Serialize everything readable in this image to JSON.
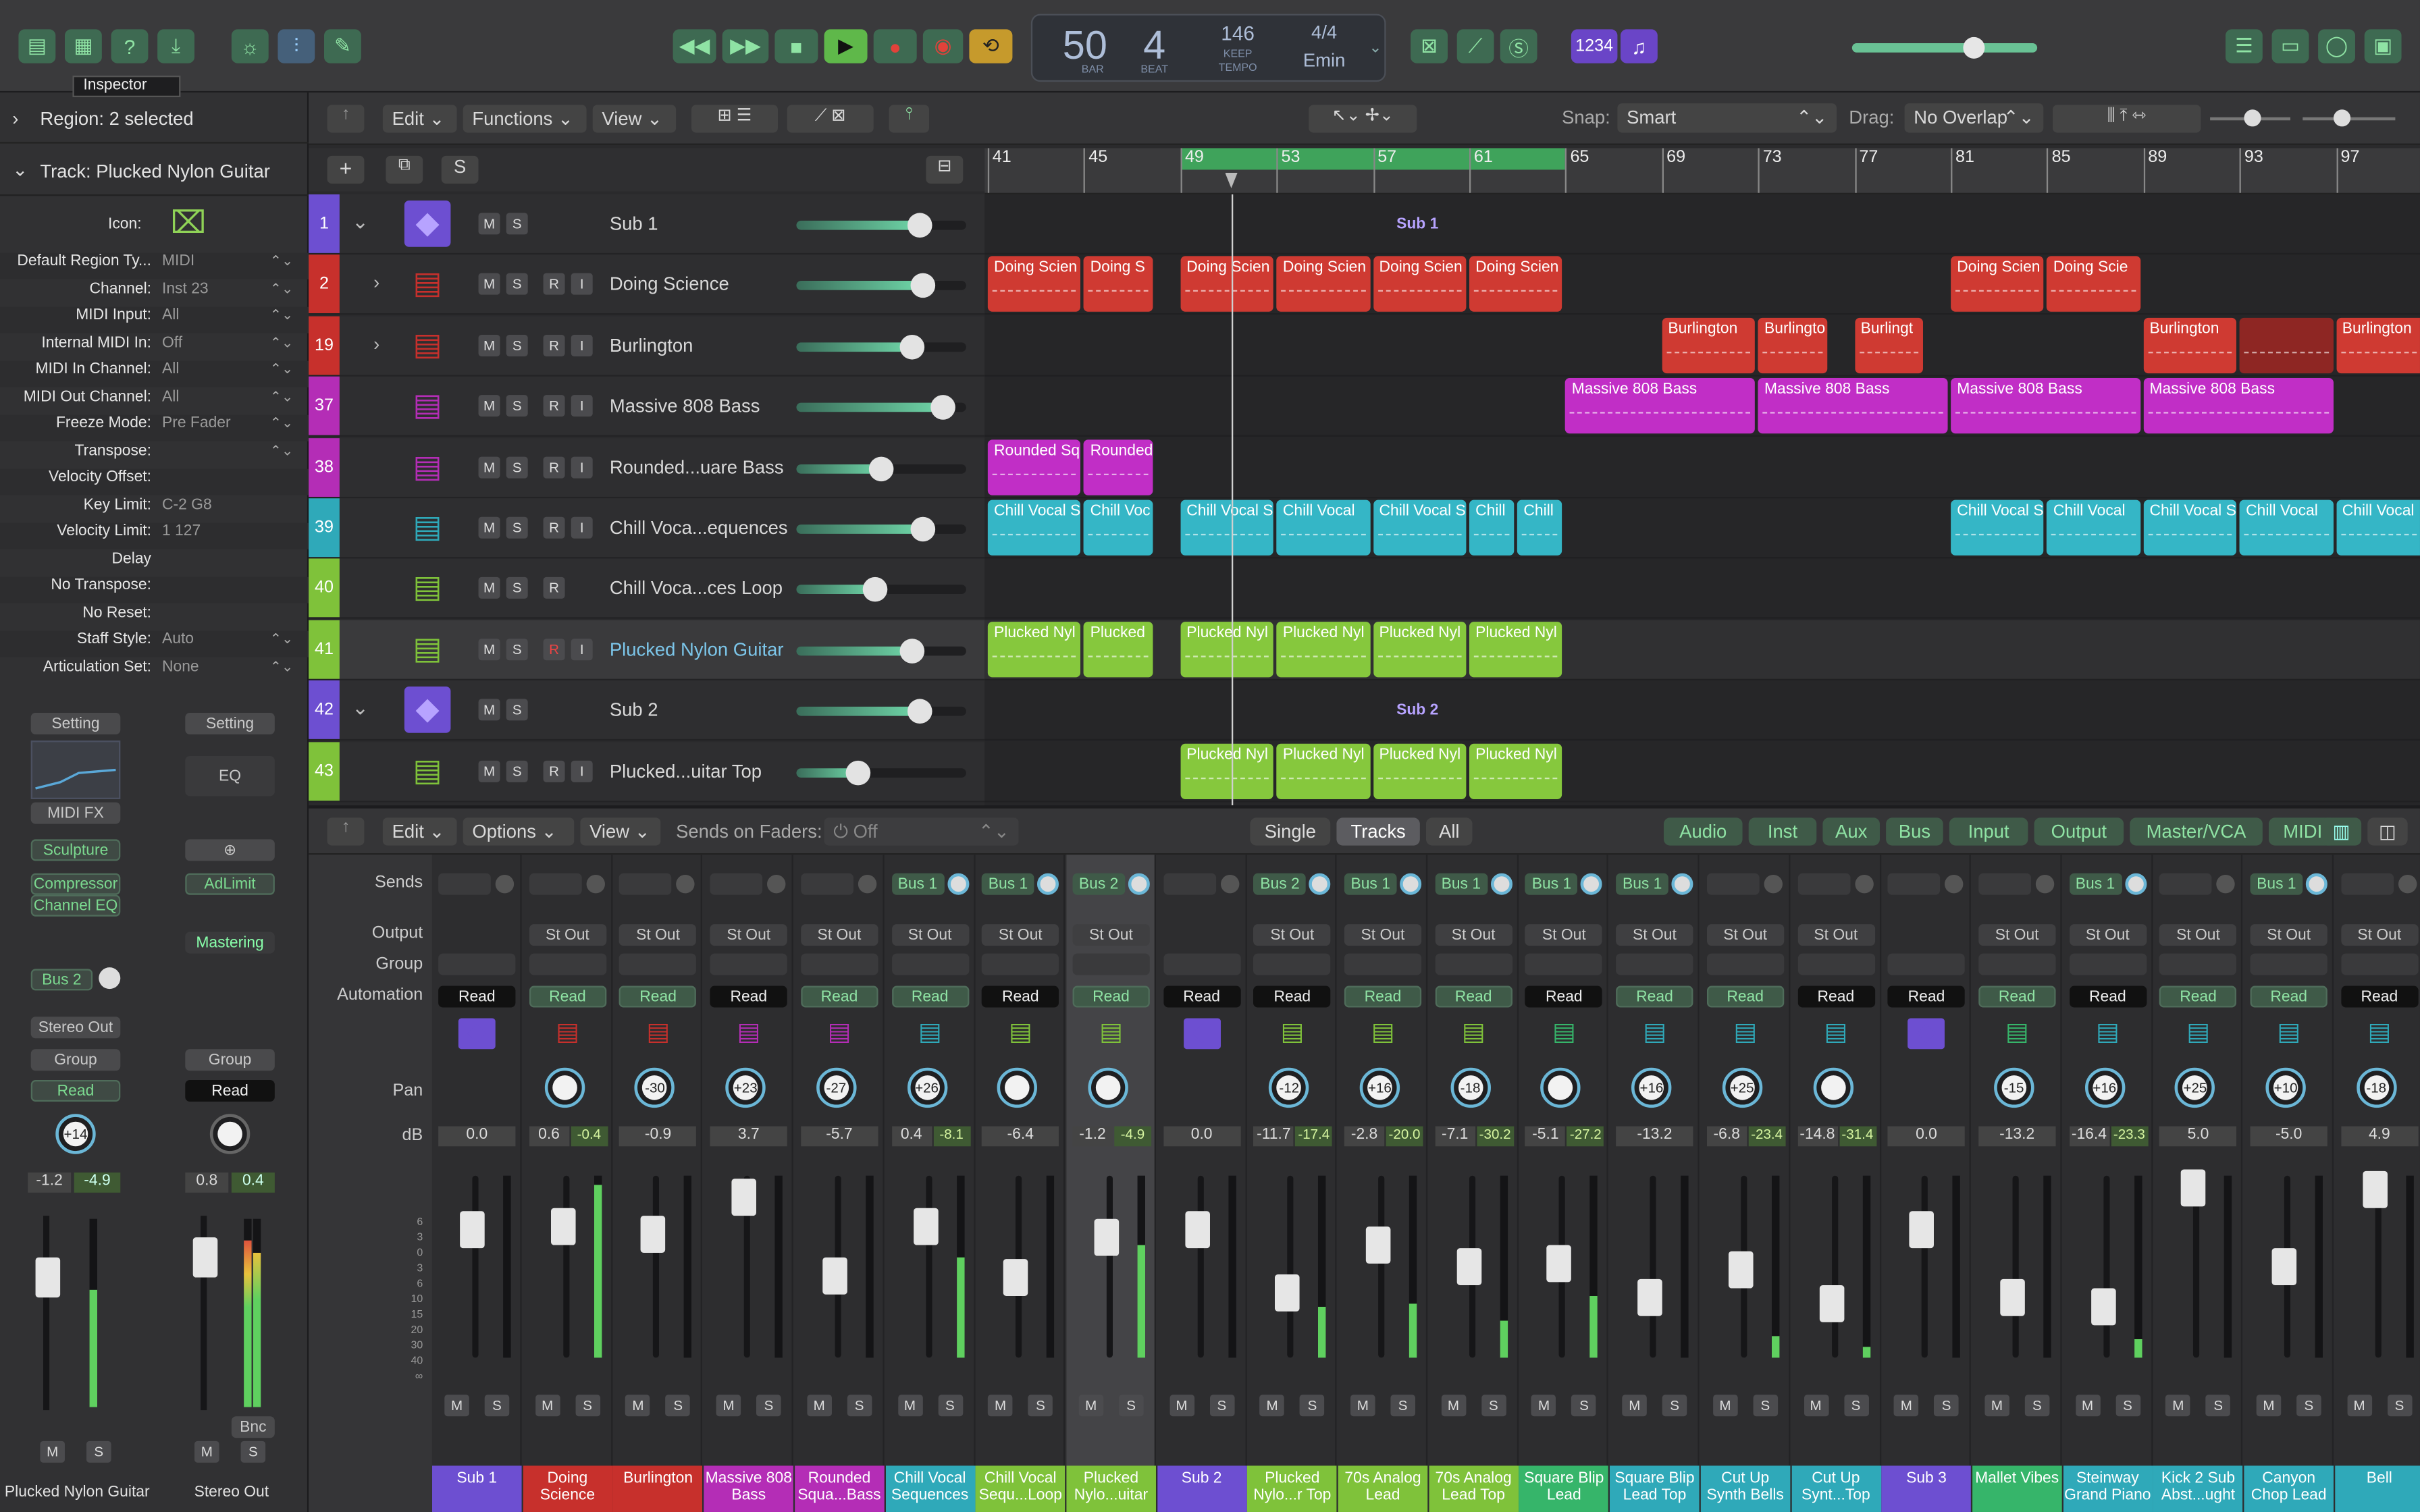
{
  "control_bar": {
    "tooltip": "Inspector",
    "lcd": {
      "bar": "50",
      "beat": "4",
      "bar_label": "BAR",
      "beat_label": "BEAT",
      "tempo": "146",
      "tempo_sub": "KEEP",
      "tempo_label": "TEMPO",
      "sig": "4/4",
      "key": "Emin",
      "count": "1234"
    }
  },
  "inspector": {
    "region_header": "Region: 2 selected",
    "track_header": "Track:  Plucked Nylon Guitar",
    "icon_label": "Icon:",
    "params": [
      {
        "k": "Default Region Ty...",
        "v": "MIDI",
        "ar": "⌃⌄"
      },
      {
        "k": "Channel:",
        "v": "Inst 23",
        "ar": "⌃⌄"
      },
      {
        "k": "MIDI Input:",
        "v": "All",
        "ar": "⌃⌄"
      },
      {
        "k": "Internal MIDI In:",
        "v": "Off",
        "ar": "⌃⌄"
      },
      {
        "k": "MIDI In Channel:",
        "v": "All",
        "ar": "⌃⌄"
      },
      {
        "k": "MIDI Out Channel:",
        "v": "All",
        "ar": "⌃⌄"
      },
      {
        "k": "Freeze Mode:",
        "v": "Pre Fader",
        "ar": "⌃⌄"
      },
      {
        "k": "Transpose:",
        "v": "",
        "ar": "⌃⌄"
      },
      {
        "k": "Velocity Offset:",
        "v": "",
        "ar": ""
      },
      {
        "k": "Key Limit:",
        "v": "C-2  G8",
        "ar": ""
      },
      {
        "k": "Velocity Limit:",
        "v": "1  127",
        "ar": ""
      },
      {
        "k": "Delay",
        "v": "",
        "ar": ""
      },
      {
        "k": "No Transpose:",
        "v": "",
        "ar": ""
      },
      {
        "k": "No Reset:",
        "v": "",
        "ar": ""
      },
      {
        "k": "Staff Style:",
        "v": "Auto",
        "ar": "⌃⌄"
      },
      {
        "k": "Articulation Set:",
        "v": "None",
        "ar": "⌃⌄"
      }
    ],
    "left_strip": {
      "setting": "Setting",
      "midi_fx": "MIDI FX",
      "plugins": [
        "Sculpture",
        "Compressor",
        "Channel EQ"
      ],
      "send": "Bus 2",
      "output": "Stereo Out",
      "group": "Group",
      "auto": "Read",
      "pan": "+14",
      "db1": "-1.2",
      "db2": "-4.9",
      "name": "Plucked Nylon Guitar"
    },
    "right_strip": {
      "setting": "Setting",
      "eq": "EQ",
      "plugins": [
        "AdLimit"
      ],
      "mastering": "Mastering",
      "group": "Group",
      "auto": "Read",
      "db1": "0.8",
      "db2": "0.4",
      "bnc": "Bnc",
      "name": "Stereo Out"
    }
  },
  "tracks_toolbar": {
    "edit": "Edit",
    "functions": "Functions",
    "view": "View",
    "snap_label": "Snap:",
    "snap": "Smart",
    "drag_label": "Drag:",
    "drag": "No Overlap"
  },
  "ruler": [
    "41",
    "45",
    "49",
    "53",
    "57",
    "61",
    "65",
    "69",
    "73",
    "77",
    "81",
    "85",
    "89",
    "93",
    "97"
  ],
  "tracks": [
    {
      "num": "1",
      "name": "Sub 1",
      "color": "#6d4fd1",
      "folder": true,
      "rec": false,
      "knob": 0.72
    },
    {
      "num": "2",
      "name": "Doing Science",
      "color": "#c7302c",
      "folder": false,
      "disc": true,
      "rec": true,
      "knob": 0.74
    },
    {
      "num": "19",
      "name": "Burlington",
      "color": "#c7302c",
      "folder": false,
      "disc": true,
      "rec": true,
      "knob": 0.68
    },
    {
      "num": "37",
      "name": "Massive 808 Bass",
      "color": "#b42db6",
      "folder": false,
      "rec": true,
      "knob": 0.86
    },
    {
      "num": "38",
      "name": "Rounded...uare Bass",
      "color": "#b42db6",
      "folder": false,
      "rec": true,
      "knob": 0.5
    },
    {
      "num": "39",
      "name": "Chill Voca...equences",
      "color": "#2fa9b9",
      "folder": false,
      "rec": true,
      "knob": 0.74
    },
    {
      "num": "40",
      "name": "Chill Voca...ces Loop",
      "color": "#7fc23a",
      "folder": false,
      "rec": false,
      "r_only": true,
      "knob": 0.46
    },
    {
      "num": "41",
      "name": "Plucked Nylon Guitar",
      "color": "#7fc23a",
      "folder": false,
      "rec": true,
      "selected": true,
      "knob": 0.68
    },
    {
      "num": "42",
      "name": "Sub 2",
      "color": "#6d4fd1",
      "folder": true,
      "rec": false,
      "knob": 0.72
    },
    {
      "num": "43",
      "name": "Plucked...uitar Top",
      "color": "#7fc23a",
      "folder": false,
      "rec": true,
      "knob": 0.36
    }
  ],
  "folder_labels": [
    "Sub 1",
    "Sub 2"
  ],
  "regions": [
    {
      "row": 1,
      "bar": 41,
      "len": 4,
      "label": "Doing Scien",
      "color": "#cf3a32"
    },
    {
      "row": 1,
      "bar": 45,
      "len": 3,
      "label": "Doing S",
      "color": "#cf3a32"
    },
    {
      "row": 1,
      "bar": 49,
      "len": 4,
      "label": "Doing Scien",
      "color": "#cf3a32"
    },
    {
      "row": 1,
      "bar": 53,
      "len": 4,
      "label": "Doing Scien",
      "color": "#cf3a32"
    },
    {
      "row": 1,
      "bar": 57,
      "len": 4,
      "label": "Doing Scien",
      "color": "#cf3a32"
    },
    {
      "row": 1,
      "bar": 61,
      "len": 4,
      "label": "Doing Scien",
      "color": "#cf3a32"
    },
    {
      "row": 1,
      "bar": 81,
      "len": 4,
      "label": "Doing Scien",
      "color": "#cf3a32"
    },
    {
      "row": 1,
      "bar": 85,
      "len": 4,
      "label": "Doing Scie",
      "color": "#cf3a32"
    },
    {
      "row": 2,
      "bar": 69,
      "len": 4,
      "label": "Burlington",
      "color": "#cf3a32"
    },
    {
      "row": 2,
      "bar": 73,
      "len": 3,
      "label": "Burlingto",
      "color": "#cf3a32"
    },
    {
      "row": 2,
      "bar": 77,
      "len": 3,
      "label": "Burlingt",
      "color": "#cf3a32"
    },
    {
      "row": 2,
      "bar": 89,
      "len": 4,
      "label": "Burlington",
      "color": "#cf3a32"
    },
    {
      "row": 2,
      "bar": 93,
      "len": 4,
      "label": "",
      "color": "#8e2623"
    },
    {
      "row": 2,
      "bar": 97,
      "len": 4,
      "label": "Burlington",
      "color": "#cf3a32"
    },
    {
      "row": 3,
      "bar": 65,
      "len": 8,
      "label": "Massive 808 Bass",
      "color": "#c12ec6"
    },
    {
      "row": 3,
      "bar": 73,
      "len": 8,
      "label": "Massive 808 Bass",
      "color": "#c12ec6"
    },
    {
      "row": 3,
      "bar": 81,
      "len": 8,
      "label": "Massive 808 Bass",
      "color": "#c12ec6"
    },
    {
      "row": 3,
      "bar": 89,
      "len": 8,
      "label": "Massive 808 Bass",
      "color": "#c12ec6"
    },
    {
      "row": 4,
      "bar": 41,
      "len": 4,
      "label": "Rounded Sq",
      "color": "#c12ec6"
    },
    {
      "row": 4,
      "bar": 45,
      "len": 3,
      "label": "Rounded",
      "color": "#c12ec6"
    },
    {
      "row": 5,
      "bar": 41,
      "len": 4,
      "label": "Chill Vocal S",
      "color": "#35b6c6"
    },
    {
      "row": 5,
      "bar": 45,
      "len": 3,
      "label": "Chill Voc",
      "color": "#35b6c6"
    },
    {
      "row": 5,
      "bar": 49,
      "len": 4,
      "label": "Chill Vocal S",
      "color": "#35b6c6"
    },
    {
      "row": 5,
      "bar": 53,
      "len": 4,
      "label": "Chill Vocal",
      "color": "#35b6c6"
    },
    {
      "row": 5,
      "bar": 57,
      "len": 4,
      "label": "Chill Vocal S",
      "color": "#35b6c6"
    },
    {
      "row": 5,
      "bar": 61,
      "len": 2,
      "label": "Chill",
      "color": "#35b6c6"
    },
    {
      "row": 5,
      "bar": 63,
      "len": 2,
      "label": "Chill",
      "color": "#35b6c6"
    },
    {
      "row": 5,
      "bar": 81,
      "len": 4,
      "label": "Chill Vocal S",
      "color": "#35b6c6"
    },
    {
      "row": 5,
      "bar": 85,
      "len": 4,
      "label": "Chill Vocal",
      "color": "#35b6c6"
    },
    {
      "row": 5,
      "bar": 89,
      "len": 4,
      "label": "Chill Vocal S",
      "color": "#35b6c6"
    },
    {
      "row": 5,
      "bar": 93,
      "len": 4,
      "label": "Chill Vocal",
      "color": "#35b6c6"
    },
    {
      "row": 5,
      "bar": 97,
      "len": 4,
      "label": "Chill Vocal",
      "color": "#35b6c6"
    },
    {
      "row": 7,
      "bar": 41,
      "len": 4,
      "label": "Plucked Nyl",
      "color": "#86c83d"
    },
    {
      "row": 7,
      "bar": 45,
      "len": 3,
      "label": "Plucked",
      "color": "#86c83d"
    },
    {
      "row": 7,
      "bar": 49,
      "len": 4,
      "label": "Plucked Nyl",
      "color": "#86c83d"
    },
    {
      "row": 7,
      "bar": 53,
      "len": 4,
      "label": "Plucked Nyl",
      "color": "#86c83d"
    },
    {
      "row": 7,
      "bar": 57,
      "len": 4,
      "label": "Plucked Nyl",
      "color": "#86c83d"
    },
    {
      "row": 7,
      "bar": 61,
      "len": 4,
      "label": "Plucked Nyl",
      "color": "#86c83d"
    },
    {
      "row": 9,
      "bar": 49,
      "len": 4,
      "label": "Plucked Nyl",
      "color": "#86c83d"
    },
    {
      "row": 9,
      "bar": 53,
      "len": 4,
      "label": "Plucked Nyl",
      "color": "#86c83d"
    },
    {
      "row": 9,
      "bar": 57,
      "len": 4,
      "label": "Plucked Nyl",
      "color": "#86c83d"
    },
    {
      "row": 9,
      "bar": 61,
      "len": 4,
      "label": "Plucked Nyl",
      "color": "#86c83d"
    }
  ],
  "mixer_toolbar": {
    "edit": "Edit",
    "options": "Options",
    "view": "View",
    "sends_label": "Sends on Faders:",
    "sends_value": "Off",
    "single": "Single",
    "tracks": "Tracks",
    "all": "All",
    "filters": [
      "Audio",
      "Inst",
      "Aux",
      "Bus",
      "Input",
      "Output",
      "Master/VCA",
      "MIDI"
    ]
  },
  "mixer_labels": {
    "sends": "Sends",
    "output": "Output",
    "group": "Group",
    "automation": "Automation",
    "pan": "Pan",
    "db": "dB"
  },
  "strips": [
    {
      "name": "Sub 1",
      "color": "#6d4fd1",
      "send": "",
      "out": "",
      "auto": "Read",
      "pan": "",
      "db": "0.0",
      "db2": "",
      "fader": 0.7,
      "meter": 0
    },
    {
      "name": "Doing Science",
      "color": "#c7302c",
      "send": "",
      "out": "St Out",
      "auto": "Read",
      "pan": "",
      "db": "0.6",
      "db2": "-0.4",
      "fader": 0.72,
      "meter": 0.95
    },
    {
      "name": "Burlington",
      "color": "#c7302c",
      "send": "",
      "out": "St Out",
      "auto": "Read",
      "pan": "-30",
      "db": "-0.9",
      "db2": "",
      "fader": 0.68,
      "meter": 0
    },
    {
      "name": "Massive 808 Bass",
      "color": "#b42db6",
      "send": "",
      "out": "St Out",
      "auto": "Read",
      "pan": "+23",
      "db": "3.7",
      "db2": "",
      "fader": 0.88,
      "meter": 0
    },
    {
      "name": "Rounded Squa...Bass",
      "color": "#b42db6",
      "send": "",
      "out": "St Out",
      "auto": "Read",
      "pan": "-27",
      "db": "-5.7",
      "db2": "",
      "fader": 0.45,
      "meter": 0
    },
    {
      "name": "Chill Vocal Sequences",
      "color": "#2fa9b9",
      "send": "Bus 1",
      "out": "St Out",
      "auto": "Read",
      "pan": "+26",
      "db": "0.4",
      "db2": "-8.1",
      "fader": 0.72,
      "meter": 0.55
    },
    {
      "name": "Chill Vocal Sequ...Loop",
      "color": "#7fc23a",
      "send": "Bus 1",
      "out": "St Out",
      "auto": "Read",
      "pan": "",
      "db": "-6.4",
      "db2": "",
      "fader": 0.44,
      "meter": 0
    },
    {
      "name": "Plucked Nylo...uitar",
      "color": "#7fc23a",
      "send": "Bus 2",
      "out": "St Out",
      "auto": "Read",
      "pan": "",
      "db": "-1.2",
      "db2": "-4.9",
      "fader": 0.66,
      "meter": 0.62,
      "selected": true
    },
    {
      "name": "Sub 2",
      "color": "#6d4fd1",
      "send": "",
      "out": "",
      "auto": "Read",
      "pan": "",
      "db": "0.0",
      "db2": "",
      "fader": 0.7,
      "meter": 0
    },
    {
      "name": "Plucked Nylo...r Top",
      "color": "#7fc23a",
      "send": "Bus 2",
      "out": "St Out",
      "auto": "Read",
      "pan": "-12",
      "db": "-11.7",
      "db2": "-17.4",
      "fader": 0.36,
      "meter": 0.28
    },
    {
      "name": "70s Analog Lead",
      "color": "#7fc23a",
      "send": "Bus 1",
      "out": "St Out",
      "auto": "Read",
      "pan": "+16",
      "db": "-2.8",
      "db2": "-20.0",
      "fader": 0.62,
      "meter": 0.3
    },
    {
      "name": "70s Analog Lead Top",
      "color": "#7fc23a",
      "send": "Bus 1",
      "out": "St Out",
      "auto": "Read",
      "pan": "-18",
      "db": "-7.1",
      "db2": "-30.2",
      "fader": 0.5,
      "meter": 0.2
    },
    {
      "name": "Square Blip Lead",
      "color": "#36b56a",
      "send": "Bus 1",
      "out": "St Out",
      "auto": "Read",
      "pan": "",
      "db": "-5.1",
      "db2": "-27.2",
      "fader": 0.52,
      "meter": 0.34
    },
    {
      "name": "Square Blip Lead Top",
      "color": "#2fa9b9",
      "send": "Bus 1",
      "out": "St Out",
      "auto": "Read",
      "pan": "+16",
      "db": "-13.2",
      "db2": "",
      "fader": 0.33,
      "meter": 0
    },
    {
      "name": "Cut Up Synth Bells",
      "color": "#2fa9b9",
      "send": "",
      "out": "St Out",
      "auto": "Read",
      "pan": "+25",
      "db": "-6.8",
      "db2": "-23.4",
      "fader": 0.48,
      "meter": 0.12
    },
    {
      "name": "Cut Up Synt...Top",
      "color": "#2fa9b9",
      "send": "",
      "out": "St Out",
      "auto": "Read",
      "pan": "",
      "db": "-14.8",
      "db2": "-31.4",
      "fader": 0.3,
      "meter": 0.06
    },
    {
      "name": "Sub 3",
      "color": "#6d4fd1",
      "send": "",
      "out": "",
      "auto": "Read",
      "pan": "",
      "db": "0.0",
      "db2": "",
      "fader": 0.7,
      "meter": 0
    },
    {
      "name": "Mallet Vibes",
      "color": "#36b56a",
      "send": "",
      "out": "St Out",
      "auto": "Read",
      "pan": "-15",
      "db": "-13.2",
      "db2": "",
      "fader": 0.33,
      "meter": 0
    },
    {
      "name": "Steinway Grand Piano",
      "color": "#2fa9b9",
      "send": "Bus 1",
      "out": "St Out",
      "auto": "Read",
      "pan": "+16",
      "db": "-16.4",
      "db2": "-23.3",
      "fader": 0.28,
      "meter": 0.1
    },
    {
      "name": "Kick 2 Sub Abst...ught",
      "color": "#2fa9b9",
      "send": "",
      "out": "St Out",
      "auto": "Read",
      "pan": "+25",
      "db": "5.0",
      "db2": "",
      "fader": 0.93,
      "meter": 0
    },
    {
      "name": "Canyon Chop Lead",
      "color": "#2fa9b9",
      "send": "Bus 1",
      "out": "St Out",
      "auto": "Read",
      "pan": "+10",
      "db": "-5.0",
      "db2": "",
      "fader": 0.5,
      "meter": 0
    },
    {
      "name": "Bell",
      "color": "#2fa9b9",
      "send": "",
      "out": "St Out",
      "auto": "Read",
      "pan": "-18",
      "db": "4.9",
      "db2": "",
      "fader": 0.92,
      "meter": 0
    }
  ]
}
